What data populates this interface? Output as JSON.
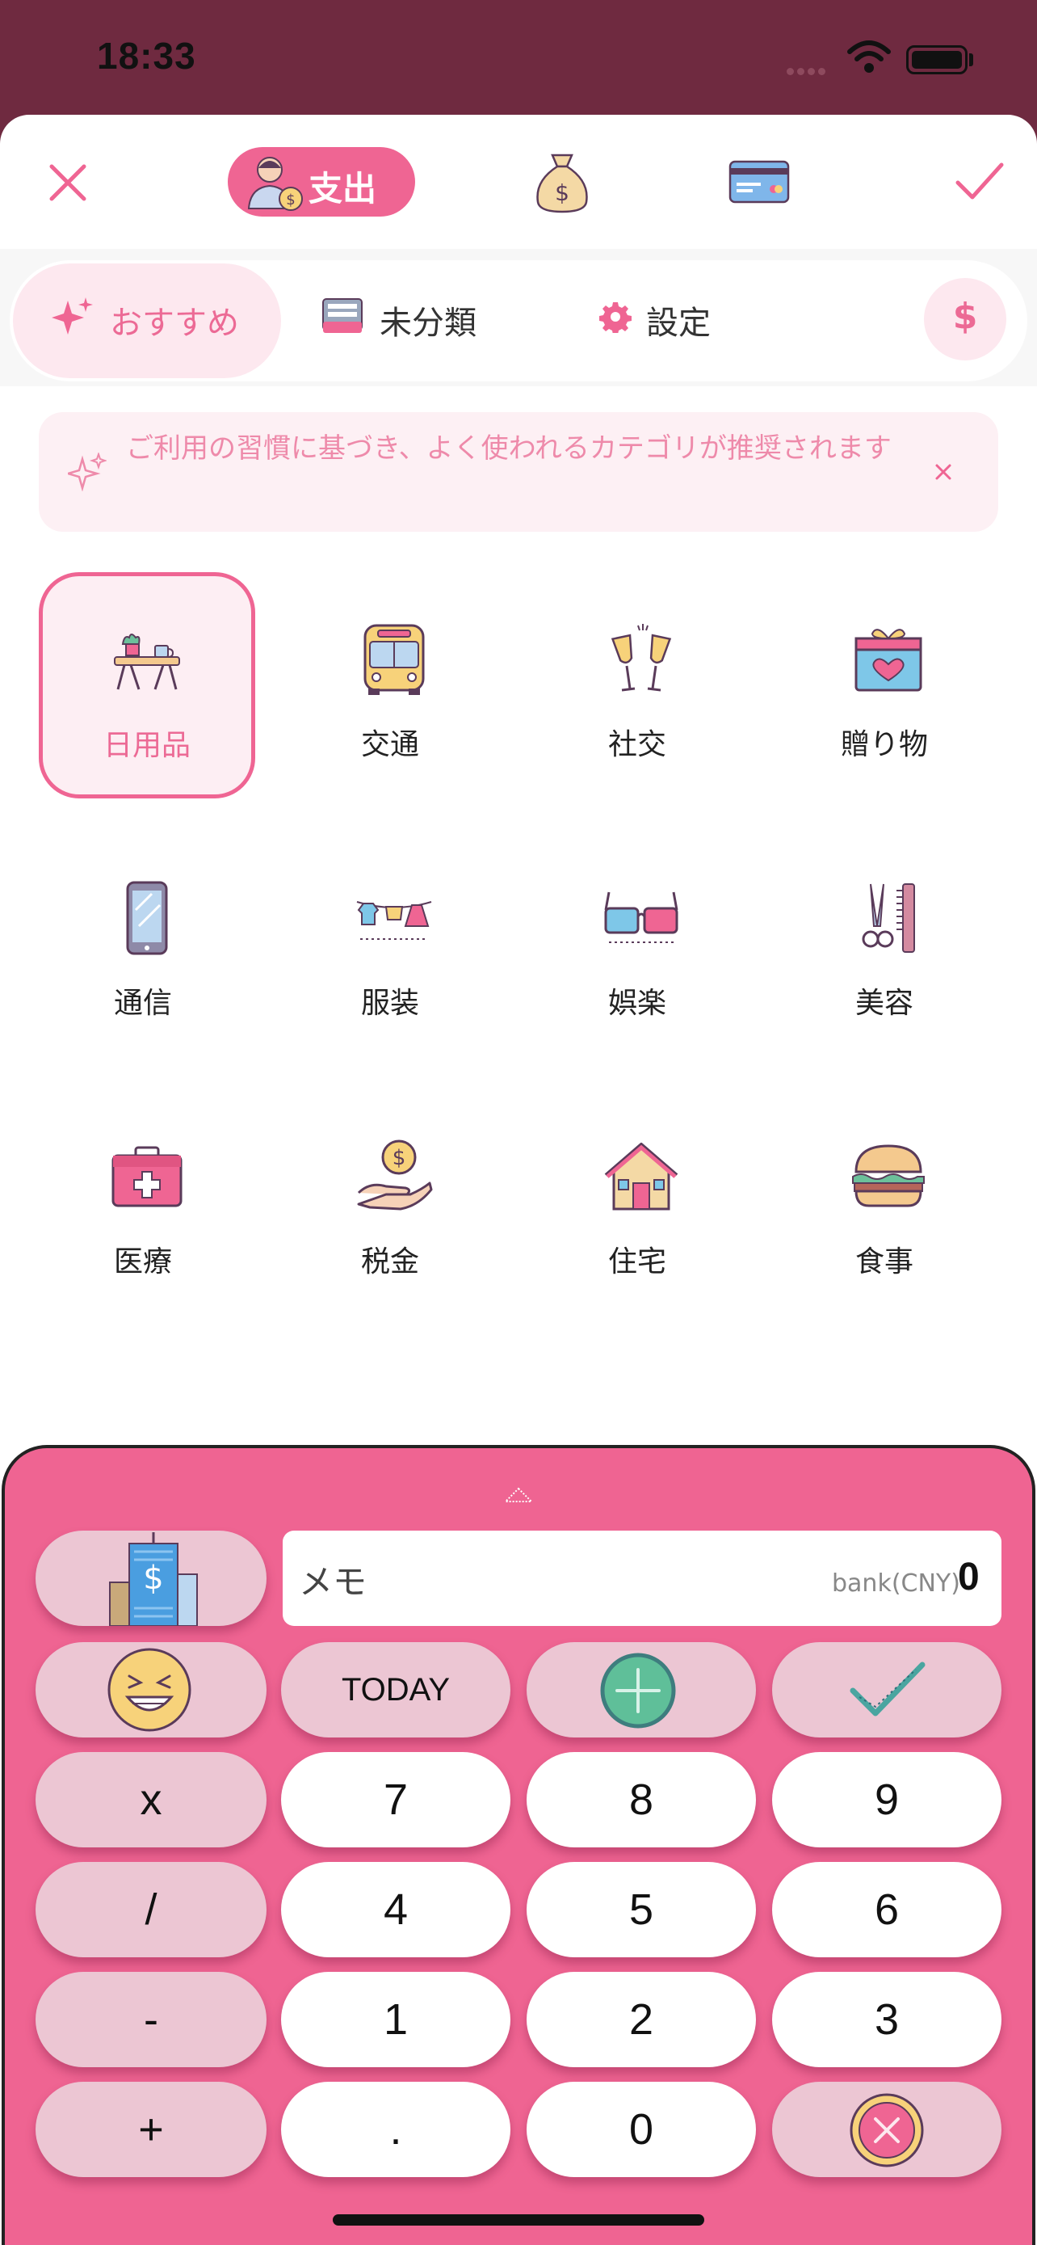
{
  "status_bar": {
    "time": "18:33"
  },
  "header": {
    "tabs": [
      {
        "label": "支出",
        "icon": "expense-person-icon",
        "active": true
      },
      {
        "label": "",
        "icon": "money-bag-icon"
      },
      {
        "label": "",
        "icon": "credit-card-icon"
      }
    ],
    "close_icon": "close-icon",
    "confirm_icon": "checkmark-icon"
  },
  "filters": {
    "recommended": "おすすめ",
    "uncategorized": "未分類",
    "settings": "設定",
    "currency_symbol": "$"
  },
  "notice": {
    "text": "ご利用の習慣に基づき、よく使われるカテゴリが推奨されます"
  },
  "categories": [
    {
      "label": "日用品",
      "icon": "picnic-table-icon",
      "selected": true
    },
    {
      "label": "交通",
      "icon": "bus-icon"
    },
    {
      "label": "社交",
      "icon": "champagne-glasses-icon"
    },
    {
      "label": "贈り物",
      "icon": "gift-box-icon"
    },
    {
      "label": "通信",
      "icon": "smartphone-icon"
    },
    {
      "label": "服装",
      "icon": "clothesline-icon"
    },
    {
      "label": "娯楽",
      "icon": "3d-glasses-icon"
    },
    {
      "label": "美容",
      "icon": "scissors-comb-icon"
    },
    {
      "label": "医療",
      "icon": "first-aid-kit-icon"
    },
    {
      "label": "税金",
      "icon": "hand-coin-icon"
    },
    {
      "label": "住宅",
      "icon": "house-icon"
    },
    {
      "label": "食事",
      "icon": "burger-icon"
    }
  ],
  "keypad": {
    "memo_placeholder": "メモ",
    "account": "bank(CNY)",
    "amount": "0",
    "today": "TODAY",
    "keys": {
      "multiply": "x",
      "divide": "/",
      "minus": "-",
      "plus": "+",
      "k7": "7",
      "k8": "8",
      "k9": "9",
      "k4": "4",
      "k5": "5",
      "k6": "6",
      "k1": "1",
      "k2": "2",
      "k3": "3",
      "dot": ".",
      "k0": "0"
    },
    "colors": {
      "accent": "#ef6492",
      "operator": "#ecc6d3"
    }
  }
}
